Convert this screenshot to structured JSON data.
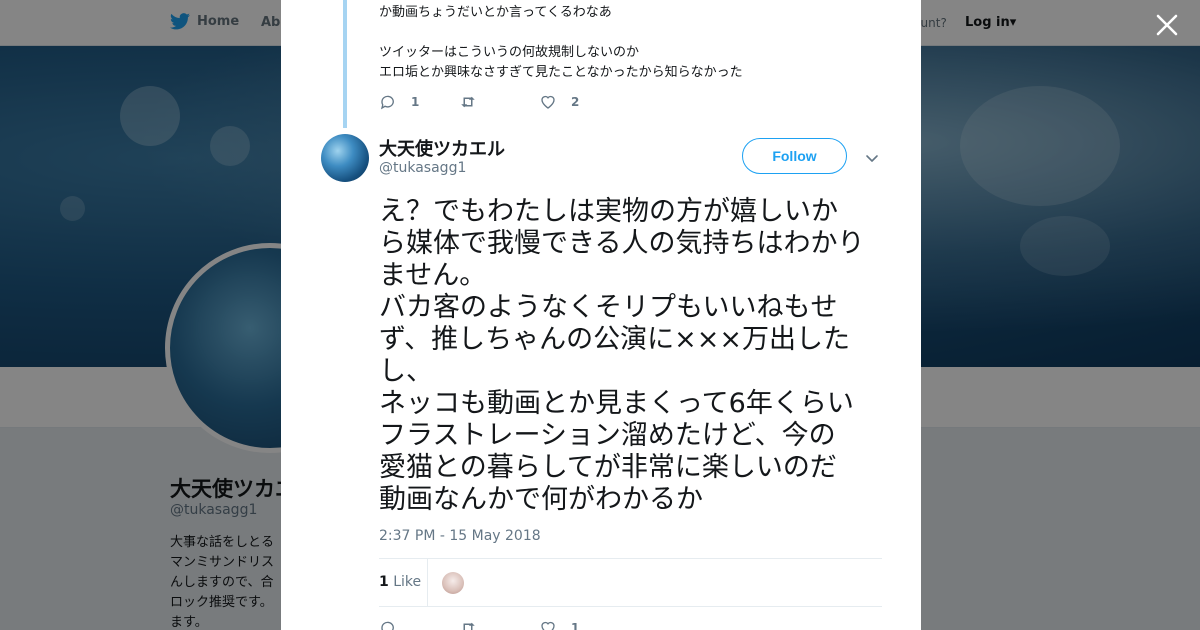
{
  "topbar": {
    "home_label": "Home",
    "about_label": "Abo",
    "account_question": "ccount?",
    "login_label": "Log in",
    "icons": {
      "bird": "twitter-bird-icon",
      "caret": "caret-down-icon"
    }
  },
  "profile": {
    "name": "大天使ツカエ",
    "handle": "@tukasagg1",
    "bio_lines": [
      "大事な話をしとる",
      "マンミサンドリス",
      "んしますので、合",
      "ロック推奨です。",
      "ます。"
    ]
  },
  "modal": {
    "close_icon": "close-icon",
    "previous_tweet": {
      "lines": [
        "か動画ちょうだいとか言ってくるわなあ",
        "",
        "ツイッターはこういうの何故規制しないのか",
        "エロ垢とか興味なさすぎて見たことなかったから知らなかった"
      ],
      "replies": "1",
      "retweets": "",
      "likes": "2"
    },
    "tweet": {
      "author_name": "大天使ツカエル",
      "author_handle": "@tukasagg1",
      "follow_label": "Follow",
      "lines": [
        "え？でもわたしは実物の方が嬉しいか",
        "ら媒体で我慢できる人の気持ちはわかり",
        "ません。",
        "バカ客のようなくそリプもいいねもせ",
        "ず、推しちゃんの公演に×××万出した",
        "し、",
        "ネッコも動画とか見まくって6年くらい",
        "フラストレーション溜めたけど、今の",
        "愛猫との暮らしてが非常に楽しいのだ",
        "動画なんかで何がわかるか"
      ],
      "timestamp": "2:37 PM - 15 May 2018",
      "like_count": "1",
      "like_label": "Like",
      "bottom_replies": "",
      "bottom_retweets": "",
      "bottom_likes": "1"
    }
  },
  "colors": {
    "accent": "#1da1f2",
    "muted": "#657786",
    "thread_line": "#a6d4f2"
  }
}
